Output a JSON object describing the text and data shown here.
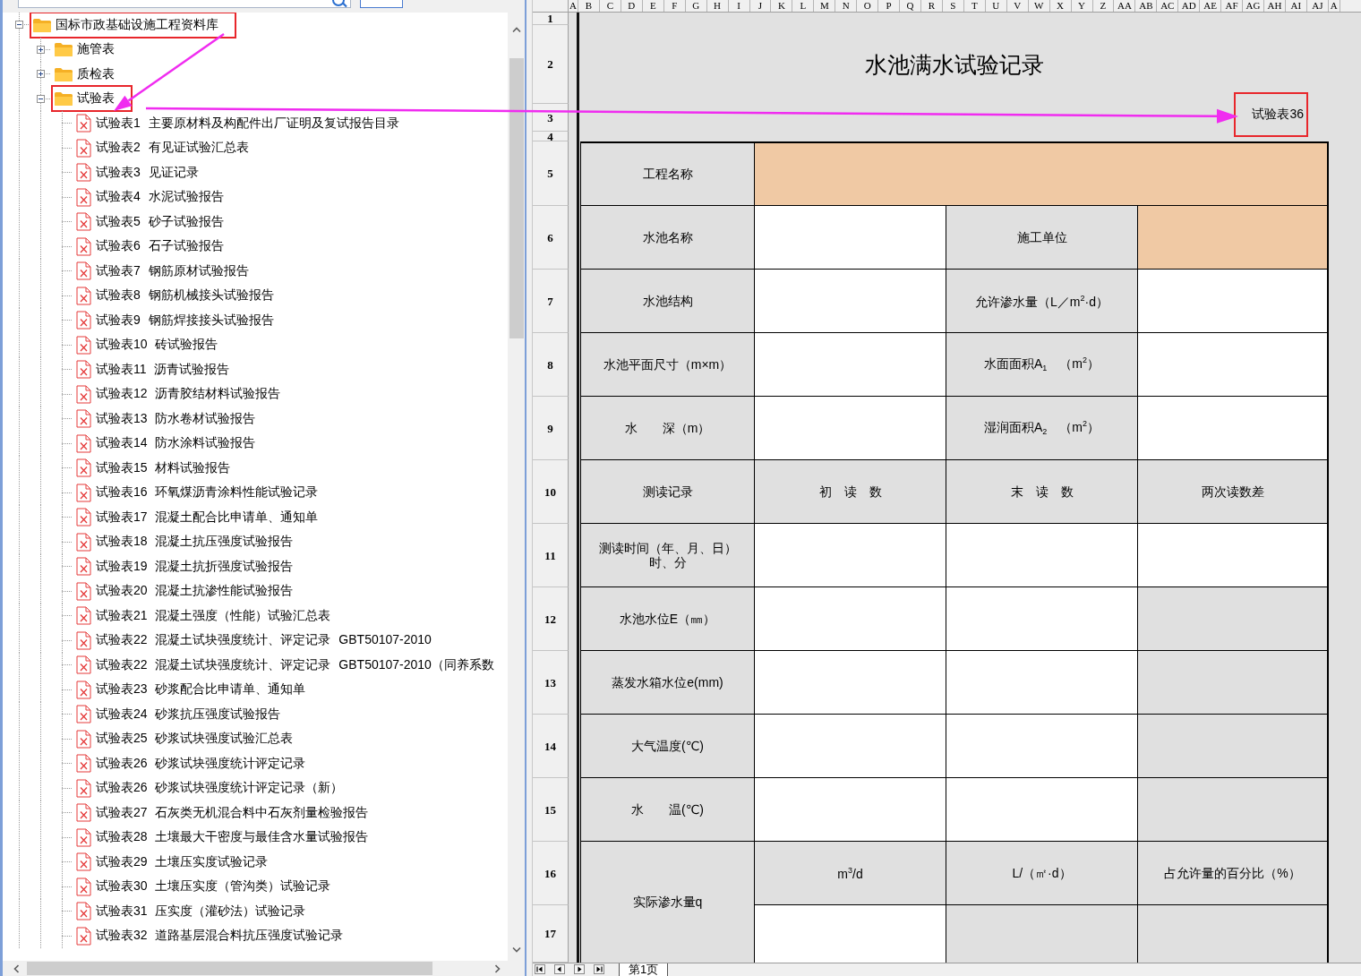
{
  "tree": [
    {
      "kind": "folder",
      "label": "国标市政基础设施工程资料库",
      "expanded": true,
      "highlighted": true,
      "children": [
        {
          "kind": "folder",
          "label": "施管表",
          "expanded": false,
          "highlighted": false
        },
        {
          "kind": "folder",
          "label": "质检表",
          "expanded": false,
          "highlighted": false
        },
        {
          "kind": "folder",
          "label": "试验表",
          "expanded": true,
          "highlighted": true,
          "children": [
            {
              "kind": "file",
              "label": "试验表1 主要原材料及构配件出厂证明及复试报告目录"
            },
            {
              "kind": "file",
              "label": "试验表2 有见证试验汇总表"
            },
            {
              "kind": "file",
              "label": "试验表3 见证记录"
            },
            {
              "kind": "file",
              "label": "试验表4 水泥试验报告"
            },
            {
              "kind": "file",
              "label": "试验表5 砂子试验报告"
            },
            {
              "kind": "file",
              "label": "试验表6 石子试验报告"
            },
            {
              "kind": "file",
              "label": "试验表7 钢筋原材试验报告"
            },
            {
              "kind": "file",
              "label": "试验表8 钢筋机械接头试验报告"
            },
            {
              "kind": "file",
              "label": "试验表9 钢筋焊接接头试验报告"
            },
            {
              "kind": "file",
              "label": "试验表10 砖试验报告"
            },
            {
              "kind": "file",
              "label": "试验表11 沥青试验报告"
            },
            {
              "kind": "file",
              "label": "试验表12 沥青胶结材料试验报告"
            },
            {
              "kind": "file",
              "label": "试验表13 防水卷材试验报告"
            },
            {
              "kind": "file",
              "label": "试验表14 防水涂料试验报告"
            },
            {
              "kind": "file",
              "label": "试验表15 材料试验报告"
            },
            {
              "kind": "file",
              "label": "试验表16 环氧煤沥青涂料性能试验记录"
            },
            {
              "kind": "file",
              "label": "试验表17 混凝土配合比申请单、通知单"
            },
            {
              "kind": "file",
              "label": "试验表18 混凝土抗压强度试验报告"
            },
            {
              "kind": "file",
              "label": "试验表19 混凝土抗折强度试验报告"
            },
            {
              "kind": "file",
              "label": "试验表20 混凝土抗渗性能试验报告"
            },
            {
              "kind": "file",
              "label": "试验表21 混凝土强度（性能）试验汇总表"
            },
            {
              "kind": "file",
              "label": "试验表22 混凝土试块强度统计、评定记录 GBT50107-2010"
            },
            {
              "kind": "file",
              "label": "试验表22 混凝土试块强度统计、评定记录 GBT50107-2010（同养系数"
            },
            {
              "kind": "file",
              "label": "试验表23 砂浆配合比申请单、通知单"
            },
            {
              "kind": "file",
              "label": "试验表24 砂浆抗压强度试验报告"
            },
            {
              "kind": "file",
              "label": "试验表25 砂浆试块强度试验汇总表"
            },
            {
              "kind": "file",
              "label": "试验表26 砂浆试块强度统计评定记录"
            },
            {
              "kind": "file",
              "label": "试验表26 砂浆试块强度统计评定记录（新）"
            },
            {
              "kind": "file",
              "label": "试验表27 石灰类无机混合料中石灰剂量检验报告"
            },
            {
              "kind": "file",
              "label": "试验表28 土壤最大干密度与最佳含水量试验报告"
            },
            {
              "kind": "file",
              "label": "试验表29 土壤压实度试验记录"
            },
            {
              "kind": "file",
              "label": "试验表30 土壤压实度（管沟类）试验记录"
            },
            {
              "kind": "file",
              "label": "试验表31 压实度（灌砂法）试验记录"
            },
            {
              "kind": "file",
              "label": "试验表32 道路基层混合料抗压强度试验记录"
            }
          ]
        }
      ]
    }
  ],
  "sheet": {
    "columns": [
      "A",
      "B",
      "C",
      "D",
      "E",
      "F",
      "G",
      "H",
      "I",
      "J",
      "K",
      "L",
      "M",
      "N",
      "O",
      "P",
      "Q",
      "R",
      "S",
      "T",
      "U",
      "V",
      "W",
      "X",
      "Y",
      "Z",
      "AA",
      "AB",
      "AC",
      "AD",
      "AE",
      "AF",
      "AG",
      "AH",
      "AI",
      "AJ",
      "A"
    ],
    "row_numbers": [
      "1",
      "2",
      "3",
      "4",
      "5",
      "6",
      "7",
      "8",
      "9",
      "10",
      "11",
      "12",
      "13",
      "14",
      "15",
      "16",
      "17"
    ],
    "title": "水池满水试验记录",
    "form_code": {
      "text": "试验表36",
      "highlighted": true
    },
    "table": [
      {
        "cells": [
          {
            "kind": "label",
            "text": "工程名称"
          },
          {
            "kind": "input",
            "color": "#f0c9a4"
          }
        ]
      },
      {
        "cells": [
          {
            "kind": "label",
            "text": "水池名称"
          },
          {
            "kind": "input"
          },
          {
            "kind": "label",
            "text": "施工单位"
          },
          {
            "kind": "input",
            "color": "#f0c9a4"
          }
        ]
      },
      {
        "cells": [
          {
            "kind": "label",
            "text": "水池结构"
          },
          {
            "kind": "input"
          },
          {
            "kind": "label",
            "text": "允许渗水量（L／m$^{2}$·d）"
          },
          {
            "kind": "input"
          }
        ]
      },
      {
        "cells": [
          {
            "kind": "label",
            "text": "水池平面尺寸（m×m）"
          },
          {
            "kind": "input"
          },
          {
            "kind": "label",
            "text": "水面面积A$_{1}$　（m$^{2}$）"
          },
          {
            "kind": "input"
          }
        ]
      },
      {
        "cells": [
          {
            "kind": "label",
            "text": "水　　深（m）"
          },
          {
            "kind": "input"
          },
          {
            "kind": "label",
            "text": "湿润面积A$_{2}$　（m$^{2}$）"
          },
          {
            "kind": "input"
          }
        ]
      },
      {
        "cells": [
          {
            "kind": "label",
            "text": "测读记录"
          },
          {
            "kind": "label",
            "text": "初　读　数"
          },
          {
            "kind": "label",
            "text": "末　读　数"
          },
          {
            "kind": "label",
            "text": "两次读数差"
          }
        ]
      },
      {
        "cells": [
          {
            "kind": "label",
            "text": "测读时间（年、月、日）时、分"
          },
          {
            "kind": "input"
          },
          {
            "kind": "input"
          },
          {
            "kind": "input"
          }
        ]
      },
      {
        "cells": [
          {
            "kind": "label",
            "text": "水池水位E（㎜）"
          },
          {
            "kind": "input"
          },
          {
            "kind": "input"
          },
          {
            "kind": "locked"
          }
        ]
      },
      {
        "cells": [
          {
            "kind": "label",
            "text": "蒸发水箱水位e(mm)"
          },
          {
            "kind": "input"
          },
          {
            "kind": "input"
          },
          {
            "kind": "locked"
          }
        ]
      },
      {
        "cells": [
          {
            "kind": "label",
            "text": "大气温度(℃)"
          },
          {
            "kind": "input"
          },
          {
            "kind": "input"
          },
          {
            "kind": "locked"
          }
        ]
      },
      {
        "cells": [
          {
            "kind": "label",
            "text": "水　　温(℃)"
          },
          {
            "kind": "input"
          },
          {
            "kind": "input"
          },
          {
            "kind": "locked"
          }
        ]
      },
      {
        "label": "实际渗水量q",
        "subrows": [
          {
            "cells": [
              {
                "kind": "label",
                "text": "m$^{3}$/d"
              },
              {
                "kind": "label",
                "text": "L/（㎡·d）"
              },
              {
                "kind": "label",
                "text": "占允许量的百分比（%）"
              }
            ]
          },
          {
            "cells": [
              {
                "kind": "input"
              },
              {
                "kind": "locked"
              },
              {
                "kind": "locked"
              }
            ]
          }
        ]
      }
    ]
  },
  "sheet_tabs": [
    {
      "label": "第1页",
      "selected": true
    }
  ]
}
